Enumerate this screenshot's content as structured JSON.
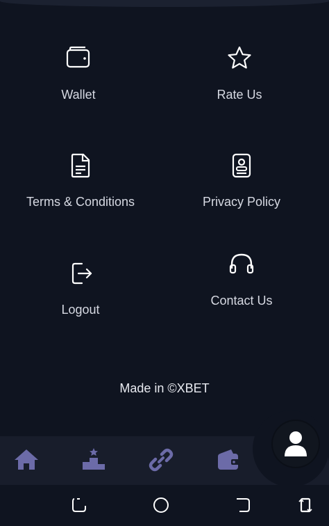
{
  "menu": {
    "wallet": "Wallet",
    "rate_us": "Rate Us",
    "terms": "Terms & Conditions",
    "privacy": "Privacy Policy",
    "logout": "Logout",
    "contact": "Contact Us"
  },
  "footer": {
    "made_in": "Made in ©XBET"
  },
  "bottom_nav": {
    "items": [
      "home-icon",
      "leaderboard-icon",
      "link-icon",
      "wallet-icon"
    ],
    "accent": "#6c6ba8"
  },
  "colors": {
    "background": "#0f1420",
    "nav": "#181d2b",
    "text": "#d6d9e2"
  }
}
